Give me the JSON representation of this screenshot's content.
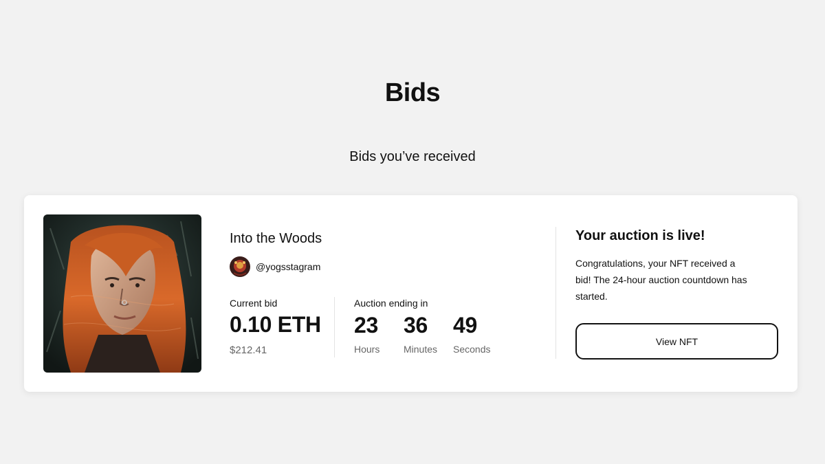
{
  "page": {
    "title": "Bids",
    "section_title": "Bids you’ve received"
  },
  "bid_card": {
    "artwork_alt": "artwork-portrait",
    "nft_title": "Into the Woods",
    "creator_handle": "@yogsstagram",
    "current_bid_label": "Current bid",
    "current_bid_value": "0.10 ETH",
    "current_bid_usd": "$212.41",
    "auction_label": "Auction ending in",
    "countdown": [
      {
        "value": "23",
        "unit": "Hours"
      },
      {
        "value": "36",
        "unit": "Minutes"
      },
      {
        "value": "49",
        "unit": "Seconds"
      }
    ],
    "status_title": "Your auction is live!",
    "status_text": "Congratulations, your NFT received a bid! The 24-hour auction countdown has started.",
    "view_button_label": "View NFT"
  },
  "colors": {
    "background": "#f2f2f2",
    "card": "#ffffff",
    "text": "#111111",
    "muted": "#666666",
    "divider": "#e3e3e3"
  }
}
